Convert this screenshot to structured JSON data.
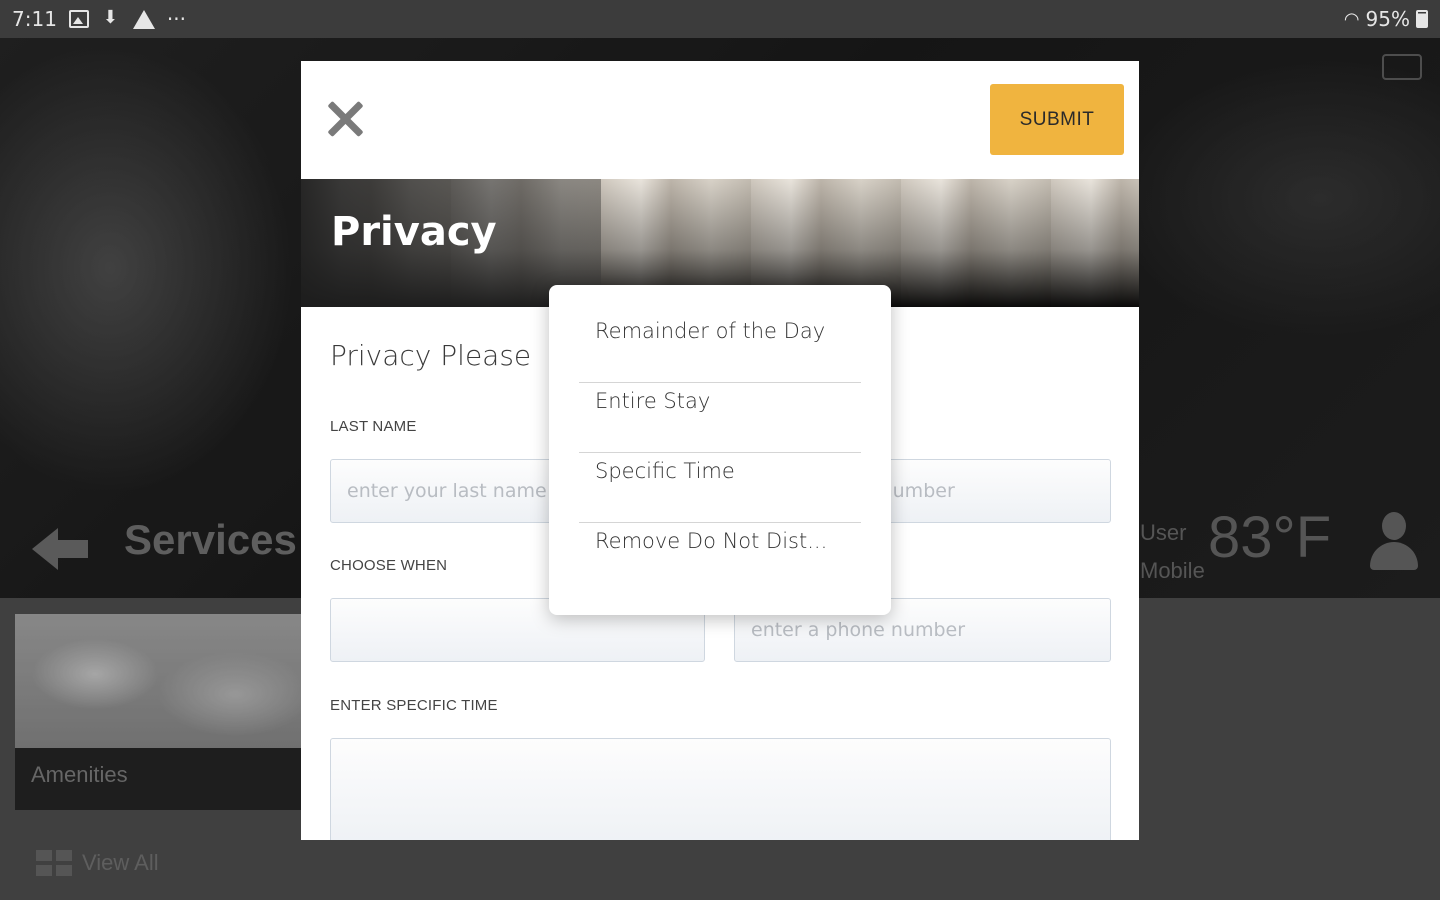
{
  "statusbar": {
    "time": "7:11",
    "more": "···",
    "battery": "95%"
  },
  "background": {
    "section_title": "Services",
    "user_line1": "User",
    "user_line2": "Mobile",
    "temperature": "83°F",
    "amenity_label": "Amenities",
    "view_all": "View All"
  },
  "modal": {
    "submit_label": "SUBMIT",
    "banner_title": "Privacy",
    "section_title": "Privacy Please",
    "last_name_label": "LAST NAME",
    "last_name_placeholder": "enter your last name",
    "room_placeholder": "enter a room number",
    "choose_when_label": "CHOOSE WHEN",
    "phone_placeholder": "enter a phone number",
    "specific_time_label": "ENTER SPECIFIC TIME"
  },
  "dropdown": {
    "options": [
      "Remainder of the Day",
      "Entire Stay",
      "Specific Time",
      "Remove Do Not Dist..."
    ]
  },
  "colors": {
    "accent": "#f0b43f",
    "status_bar": "#3c3c3c"
  }
}
